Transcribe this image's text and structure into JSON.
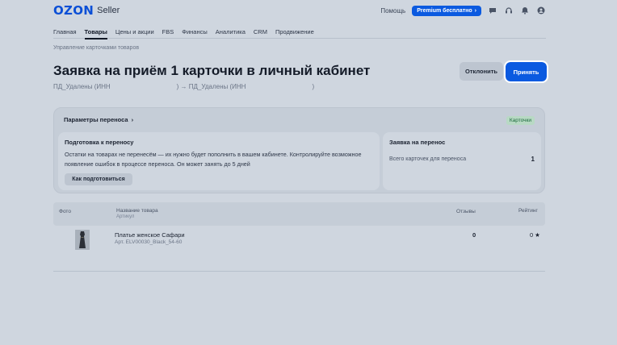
{
  "header": {
    "logo_brand": "OZON",
    "logo_product": "Seller",
    "help": "Помощь",
    "premium": "Premium бесплатно",
    "accent_color": "#0b5ae0"
  },
  "nav": {
    "items": [
      {
        "label": "Главная"
      },
      {
        "label": "Товары"
      },
      {
        "label": "Цены и акции"
      },
      {
        "label": "FBS"
      },
      {
        "label": "Финансы"
      },
      {
        "label": "Аналитика"
      },
      {
        "label": "CRM"
      },
      {
        "label": "Продвижение"
      }
    ],
    "active": "Товары"
  },
  "breadcrumb": "Управление карточками товаров",
  "page": {
    "title": "Заявка на приём 1 карточки в личный кабинет",
    "subtitle_from": "ПД_Удалены (ИНН",
    "subtitle_arrow": ") → ПД_Удалены (ИНН",
    "subtitle_end": ")",
    "reject_label": "Отклонить",
    "accept_label": "Принять"
  },
  "params": {
    "title": "Параметры переноса",
    "badge": "Карточки",
    "prep": {
      "title": "Подготовка к переносу",
      "text": "Остатки на товарах не перенесём — их нужно будет пополнить в вашем кабинете. Контролируйте возможное появление ошибок в процессе переноса. Он может занять до 5 дней",
      "button": "Как подготовиться"
    },
    "request": {
      "title": "Заявка на перенос",
      "label": "Всего карточек для переноса",
      "count": "1"
    }
  },
  "table": {
    "headers": {
      "photo": "Фото",
      "name": "Название товара",
      "article": "Артикул",
      "reviews": "Отзывы",
      "rating": "Рейтинг"
    },
    "rows": [
      {
        "name": "Платье женское Сафари",
        "article": "Арт. ELV00030_Black_54-60",
        "reviews": "0",
        "rating": "0"
      }
    ]
  }
}
